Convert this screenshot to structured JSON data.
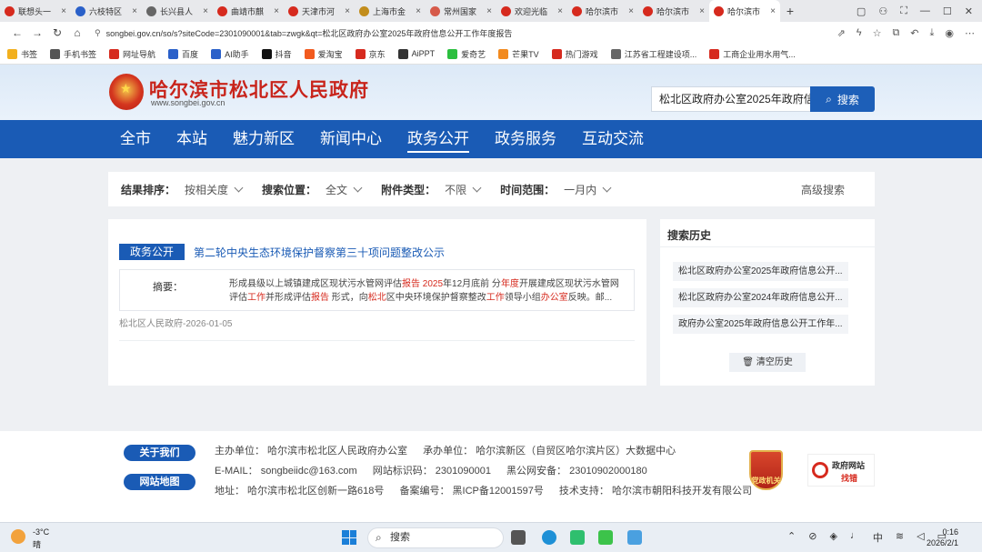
{
  "browser": {
    "tabs": [
      {
        "title": "联想头一",
        "color": "#d62a1e",
        "active": false
      },
      {
        "title": "六枝特区",
        "color": "#2a60c9",
        "active": false
      },
      {
        "title": "长兴县人",
        "color": "#666666",
        "active": false
      },
      {
        "title": "曲靖市麒",
        "color": "#d62a1e",
        "active": false
      },
      {
        "title": "天津市河",
        "color": "#d62a1e",
        "active": false
      },
      {
        "title": "上海市金",
        "color": "#c28d1c",
        "active": false
      },
      {
        "title": "常州国家",
        "color": "#d65a4a",
        "active": false
      },
      {
        "title": "欢迎光临",
        "color": "#d62a1e",
        "active": false
      },
      {
        "title": "哈尔滨市",
        "color": "#d62a1e",
        "active": false
      },
      {
        "title": "哈尔滨市",
        "color": "#d62a1e",
        "active": false
      },
      {
        "title": "哈尔滨市",
        "color": "#d62a1e",
        "active": true
      }
    ],
    "new_tab": "+",
    "url": "songbei.gov.cn/so/s?siteCode=2301090001&tab=zwgk&qt=松北区政府办公室2025年政府信息公开工作年度报告",
    "bookmarks": [
      {
        "label": "书签",
        "color": "#f2b01e"
      },
      {
        "label": "手机书签",
        "color": "#555555"
      },
      {
        "label": "网址导航",
        "color": "#d62a1e"
      },
      {
        "label": "百度",
        "color": "#2a60c9"
      },
      {
        "label": "AI助手",
        "color": "#2a60c9"
      },
      {
        "label": "抖音",
        "color": "#111111"
      },
      {
        "label": "爱淘宝",
        "color": "#f25a1e"
      },
      {
        "label": "京东",
        "color": "#d62a1e"
      },
      {
        "label": "AiPPT",
        "color": "#333333"
      },
      {
        "label": "爱奇艺",
        "color": "#2bbf3f"
      },
      {
        "label": "芒果TV",
        "color": "#f28a1e"
      },
      {
        "label": "热门游戏",
        "color": "#d62a1e"
      },
      {
        "label": "江苏省工程建设项...",
        "color": "#666666"
      },
      {
        "label": "工商企业用水用气...",
        "color": "#d62a1e"
      }
    ]
  },
  "site": {
    "name": "哈尔滨市松北区人民政府",
    "domain": "www.songbei.gov.cn",
    "search_value": "松北区政府办公室2025年政府信",
    "search_button": "搜索",
    "nav": [
      {
        "label": "全市",
        "active": false
      },
      {
        "label": "本站",
        "active": false
      },
      {
        "label": "魅力新区",
        "active": false
      },
      {
        "label": "新闻中心",
        "active": false
      },
      {
        "label": "政务公开",
        "active": true
      },
      {
        "label": "政务服务",
        "active": false
      },
      {
        "label": "互动交流",
        "active": false
      }
    ]
  },
  "filters": {
    "sort_label": "结果排序：",
    "sort_value": "按相关度",
    "position_label": "搜索位置：",
    "position_value": "全文",
    "attach_label": "附件类型：",
    "attach_value": "不限",
    "time_label": "时间范围：",
    "time_value": "一月内",
    "advanced": "高级搜索"
  },
  "results": [
    {
      "tag": "政务公开",
      "title": "第二轮中央生态环境保护督察第三十项问题整改公示",
      "summary_label": "摘要：",
      "summary_parts": [
        {
          "text": "形成县级以上城镇建成区现状污水管网评估",
          "hl": false
        },
        {
          "text": "报告",
          "hl": true
        },
        {
          "text": " ",
          "hl": false
        },
        {
          "text": "2025",
          "hl": true
        },
        {
          "text": "年12月底前 分",
          "hl": false
        },
        {
          "text": "年度",
          "hl": true
        },
        {
          "text": "开展建成区现状污水管网评估",
          "hl": false
        },
        {
          "text": "工作",
          "hl": true
        },
        {
          "text": "并形成评估",
          "hl": false
        },
        {
          "text": "报告",
          "hl": true
        },
        {
          "text": " 形式，向",
          "hl": false
        },
        {
          "text": "松北",
          "hl": true
        },
        {
          "text": "区中央环境保护督察整改",
          "hl": false
        },
        {
          "text": "工作",
          "hl": true
        },
        {
          "text": "领导小组",
          "hl": false
        },
        {
          "text": "办公室",
          "hl": true
        },
        {
          "text": "反映。邮...",
          "hl": false
        }
      ],
      "source": "松北区人民政府-2026-01-05"
    }
  ],
  "history": {
    "title": "搜索历史",
    "items": [
      "松北区政府办公室2025年政府信息公开...",
      "松北区政府办公室2024年政府信息公开...",
      "政府办公室2025年政府信息公开工作年..."
    ],
    "clear": "清空历史"
  },
  "footer": {
    "about_button": "关于我们",
    "sitemap_button": "网站地图",
    "sponsor": "主办单位：  哈尔滨市松北区人民政府办公室",
    "organizer": "承办单位：  哈尔滨新区（自贸区哈尔滨片区）大数据中心",
    "email": "E-MAIL：  songbeiidc@163.com",
    "site_code": "网站标识码：  2301090001",
    "police_record": "黑公网安备：  23010902000180",
    "address": "地址：  哈尔滨市松北区创新一路618号",
    "icp": "备案编号：  黑ICP备12001597号",
    "tech": "技术支持：  哈尔滨市朝阳科技开发有限公司",
    "badge_text": "党政机关",
    "badge2_top": "政府网站",
    "badge2_bottom": "找错"
  },
  "taskbar": {
    "temp": "-3°C",
    "weather": "晴朗",
    "search": "搜索",
    "ime": "中",
    "time": "0:16",
    "date": "2026/2/1"
  }
}
